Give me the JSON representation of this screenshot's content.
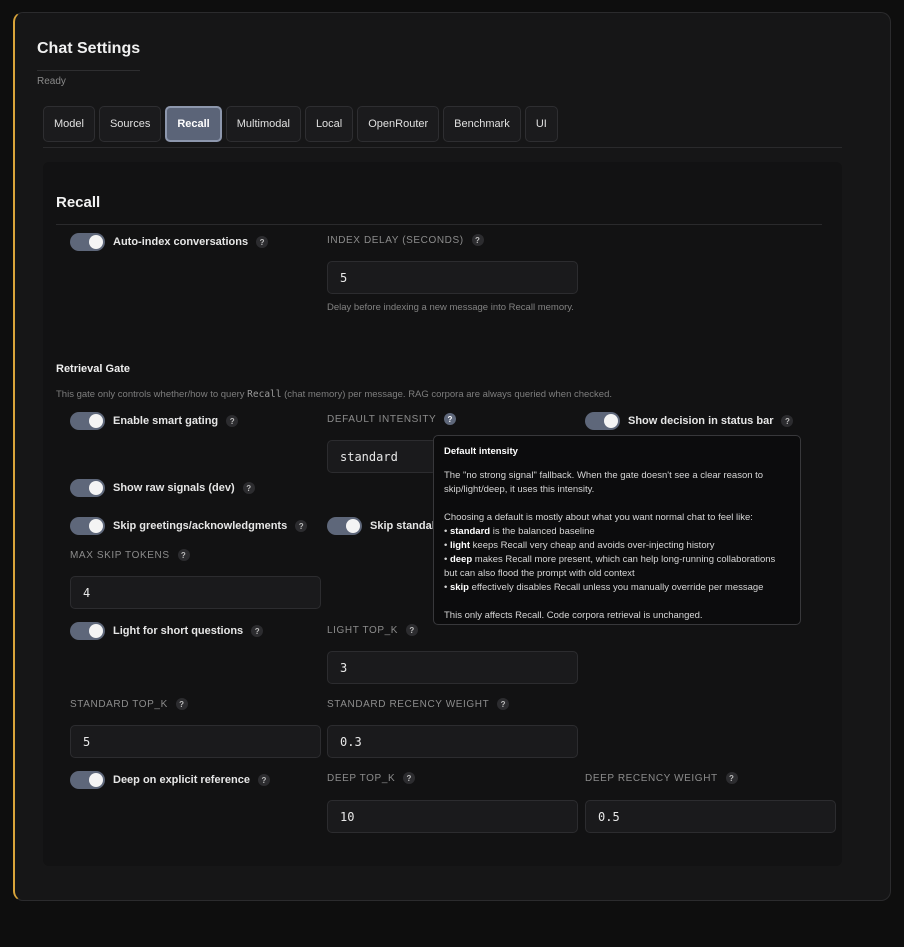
{
  "header": {
    "title": "Chat Settings",
    "status": "Ready"
  },
  "tabs": [
    {
      "label": "Model"
    },
    {
      "label": "Sources"
    },
    {
      "label": "Recall",
      "active": true
    },
    {
      "label": "Multimodal"
    },
    {
      "label": "Local"
    },
    {
      "label": "OpenRouter"
    },
    {
      "label": "Benchmark"
    },
    {
      "label": "UI"
    }
  ],
  "recall": {
    "title": "Recall",
    "auto_index_label": "Auto-index conversations",
    "index_delay_label": "INDEX DELAY (SECONDS)",
    "index_delay_value": "5",
    "index_delay_help": "Delay before indexing a new message into Recall memory."
  },
  "gate": {
    "title": "Retrieval Gate",
    "desc_pre": "This gate only controls whether/how to query ",
    "desc_mono": "Recall",
    "desc_post": " (chat memory) per message. RAG corpora are always queried when checked.",
    "smart_gating_label": "Enable smart gating",
    "default_intensity_label": "DEFAULT INTENSITY",
    "default_intensity_value": "standard",
    "show_decision_label": "Show decision in status bar",
    "raw_signals_label": "Show raw signals (dev)",
    "skip_greetings_label": "Skip greetings/acknowledgments",
    "skip_standalone_label": "Skip standalone",
    "max_skip_tokens_label": "MAX SKIP TOKENS",
    "max_skip_tokens_value": "4",
    "light_short_label": "Light for short questions",
    "light_topk_label": "LIGHT TOP_K",
    "light_topk_value": "3",
    "standard_topk_label": "STANDARD TOP_K",
    "standard_topk_value": "5",
    "standard_recency_label": "STANDARD RECENCY WEIGHT",
    "standard_recency_value": "0.3",
    "deep_explicit_label": "Deep on explicit reference",
    "deep_topk_label": "DEEP TOP_K",
    "deep_topk_value": "10",
    "deep_recency_label": "DEEP RECENCY WEIGHT",
    "deep_recency_value": "0.5"
  },
  "tooltip": {
    "title": "Default intensity",
    "line1": "The \"no strong signal\" fallback. When the gate doesn't see a clear reason to skip/light/deep, it uses this intensity.",
    "line2": "Choosing a default is mostly about what you want normal chat to feel like:",
    "b1_key": "standard",
    "b1_text": " is the balanced baseline",
    "b2_key": "light",
    "b2_text": " keeps Recall very cheap and avoids over-injecting history",
    "b3_key": "deep",
    "b3_text": " makes Recall more present, which can help long-running collaborations but can also flood the prompt with old context",
    "b4_key": "skip",
    "b4_text": " effectively disables Recall unless you manually override per message",
    "footer": "This only affects Recall. Code corpora retrieval is unchanged.",
    "bullet": "•"
  },
  "icons": {
    "help": "?"
  },
  "colors": {
    "accent": "#d9a43a",
    "toggle_on": "#5e677a",
    "tab_active": "#5b6478"
  }
}
